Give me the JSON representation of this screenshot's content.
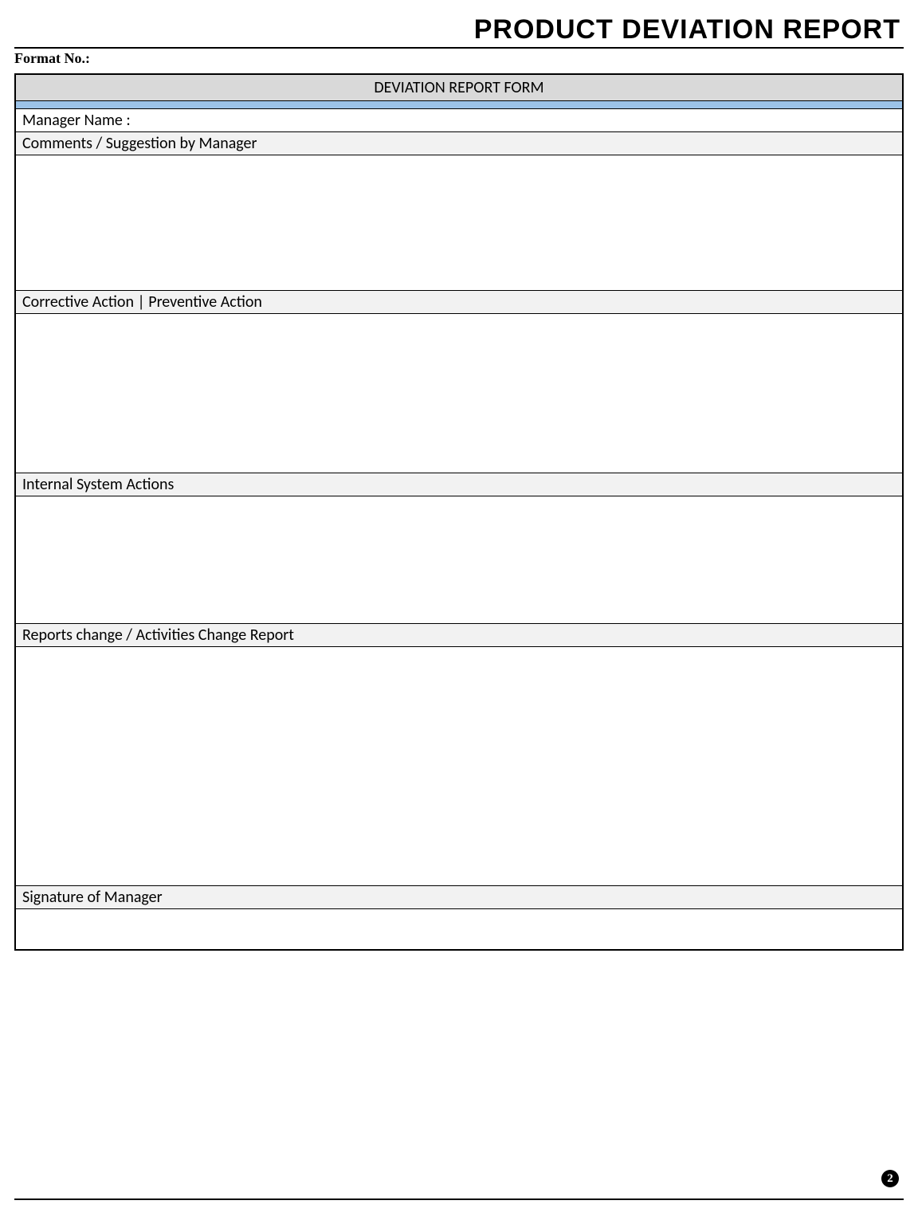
{
  "header": {
    "title": "PRODUCT DEVIATION REPORT",
    "format_no_label": "Format No.:"
  },
  "form": {
    "title": "DEVIATION REPORT FORM",
    "manager_name_label": "Manager Name :",
    "comments_label": "Comments / Suggestion by Manager",
    "corrective_label": "Corrective Action | Preventive Action",
    "internal_label": "Internal System Actions",
    "reports_change_label": "Reports change / Activities Change Report",
    "signature_label": "Signature of Manager"
  },
  "page_number": "2"
}
